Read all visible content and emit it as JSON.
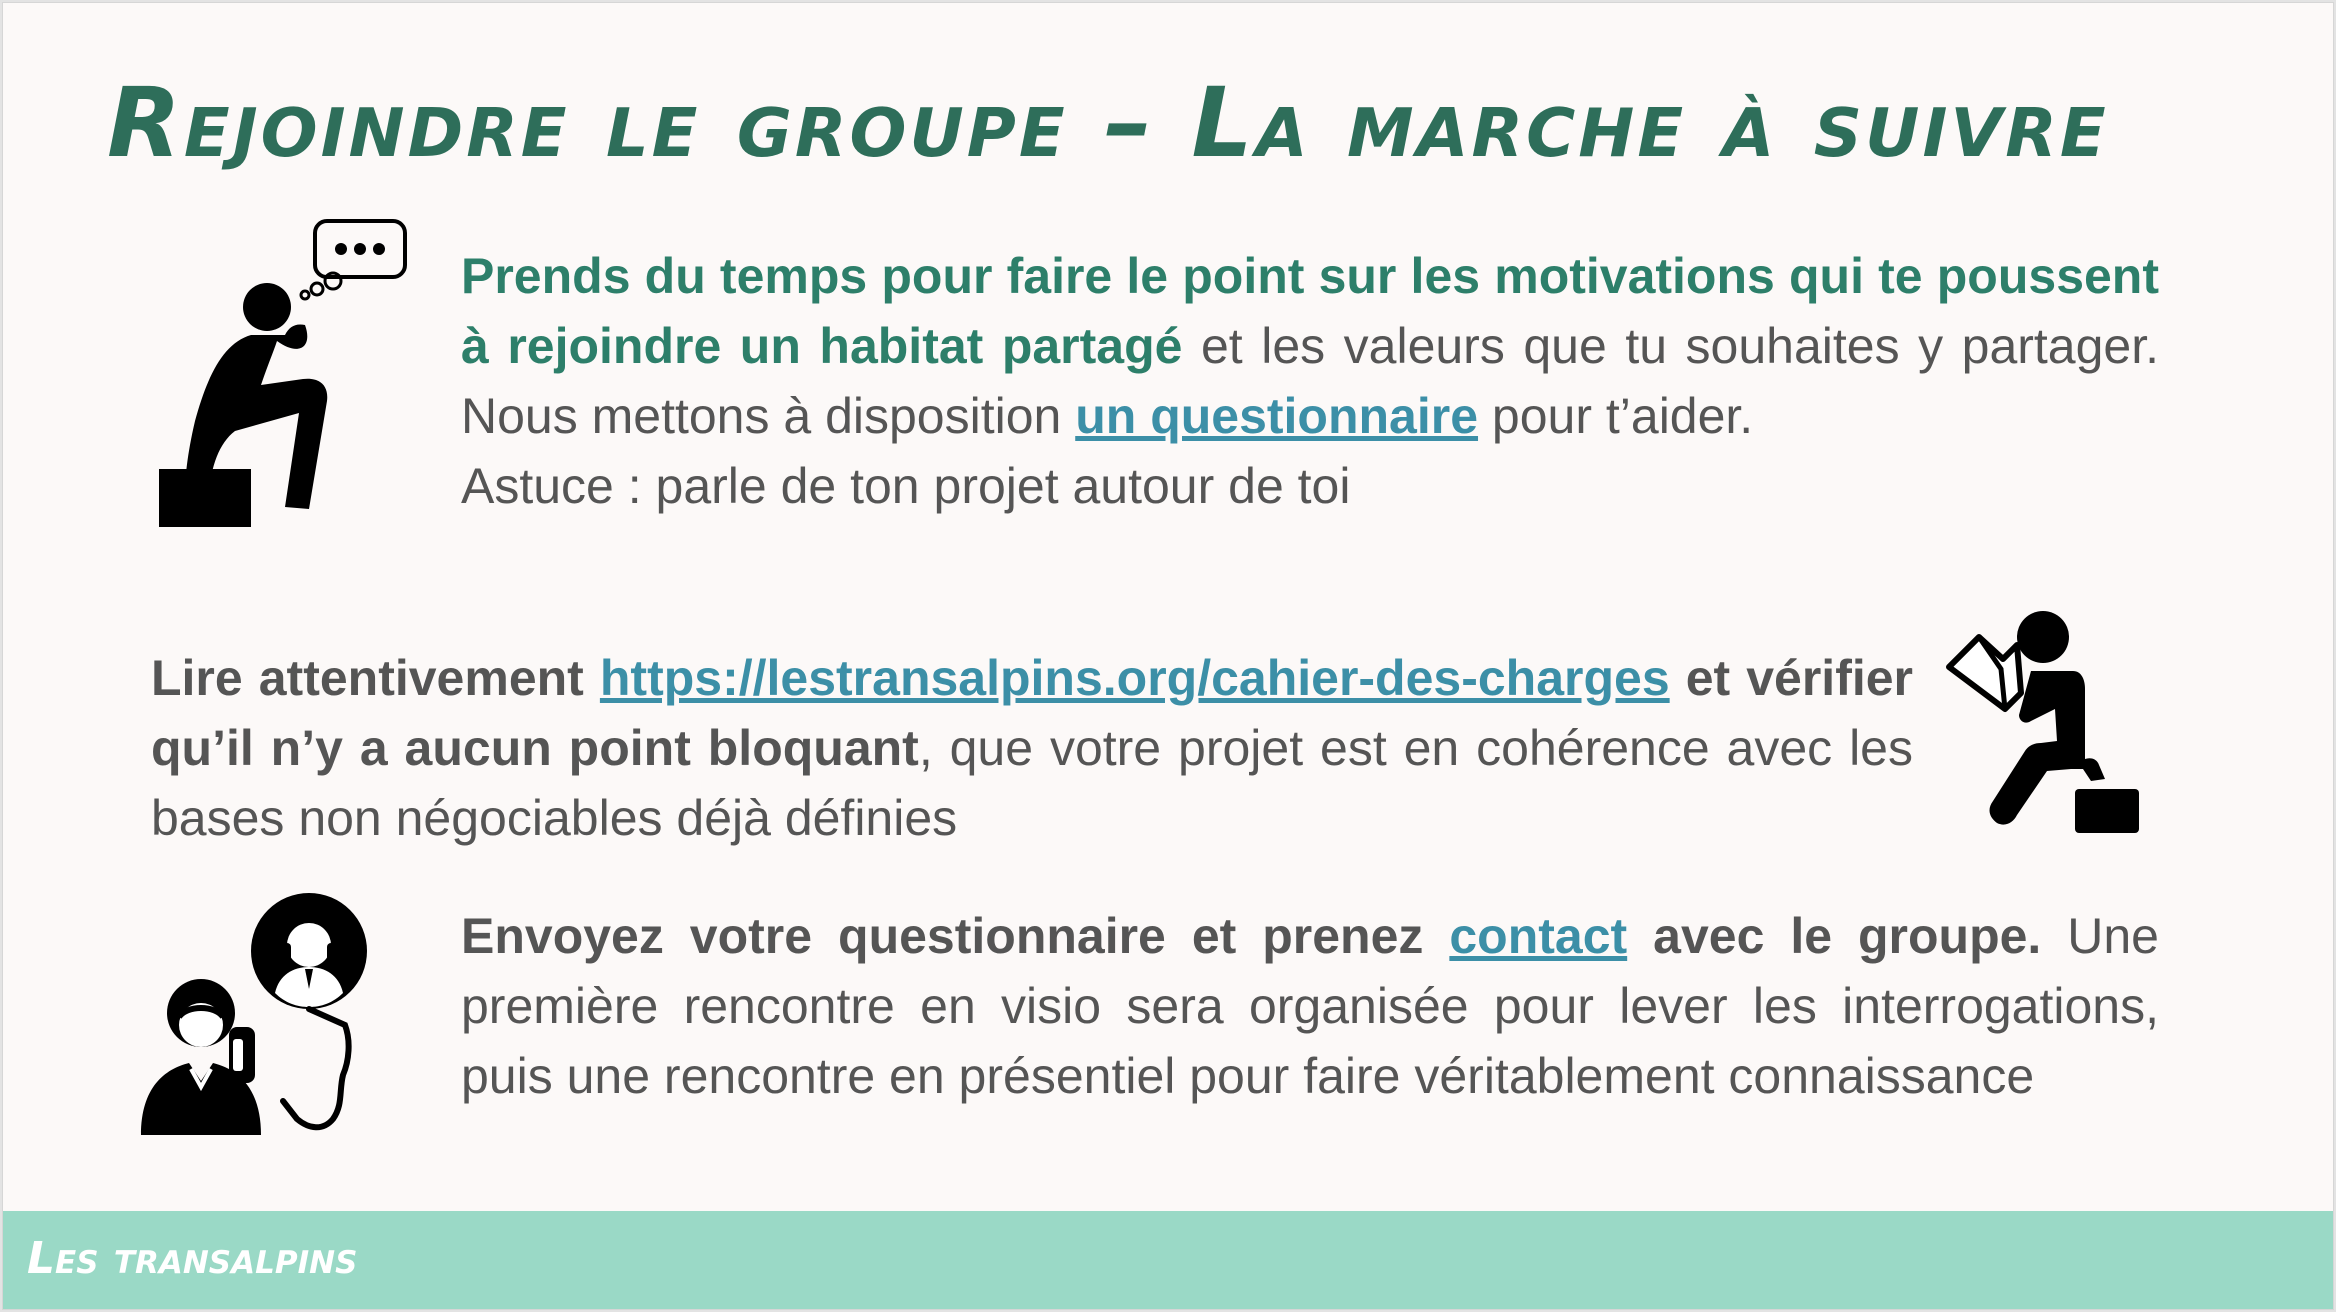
{
  "slide": {
    "title": "Rejoindre le groupe – La marche à suivre"
  },
  "step1": {
    "bold_text": "Prends du temps pour faire le point sur les motivations qui te poussent à rejoindre un habitat partagé",
    "text_before_link": " et les valeurs que tu souhaites y partager. Nous mettons à disposition ",
    "link_label": "un questionnaire",
    "text_after_link": " pour t’aider.",
    "tip": "Astuce : parle de ton projet autour de toi",
    "icon": "thinking-person-icon"
  },
  "step2": {
    "bold_lead": "Lire attentivement",
    "link_url": "https://lestransalpins.org/cahier-des-charges",
    "bold_mid": "et vérifier qu’il n’y a aucun point bloquant",
    "text_rest": ", que votre projet est en cohérence avec les bases non négociables déjà définies",
    "icon": "reading-person-icon"
  },
  "step3": {
    "bold_lead": "Envoyez votre questionnaire et prenez",
    "link_label": "contact",
    "bold_after_link": "avec le groupe.",
    "text_rest": " Une première rencontre en visio sera organisée pour lever les interrogations, puis une rencontre en présentiel pour faire véritablement connaissance",
    "icon": "video-call-icon"
  },
  "footer": {
    "brand": "Les transalpins"
  },
  "colors": {
    "title": "#2e6e5a",
    "bold_green": "#2d7f6a",
    "link": "#3c8fa7",
    "body_text": "#555555",
    "footer_band": "#9ad9c6",
    "slide_bg": "#fcf9f8"
  }
}
